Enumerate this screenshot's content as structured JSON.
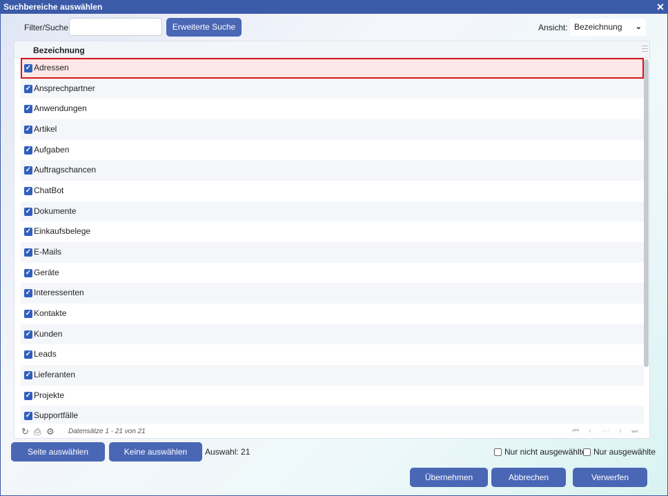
{
  "dialog": {
    "title": "Suchbereiche auswählen",
    "close_glyph": "✕"
  },
  "filter": {
    "label": "Filter/Suche:",
    "value": "",
    "placeholder": ""
  },
  "extended_search_label": "Erweiterte Suche",
  "view": {
    "label": "Ansicht:",
    "selected": "Bezeichnung"
  },
  "grid": {
    "column_header": "Bezeichnung",
    "rows": [
      {
        "label": "Adressen",
        "checked": true,
        "highlighted": true
      },
      {
        "label": "Ansprechpartner",
        "checked": true
      },
      {
        "label": "Anwendungen",
        "checked": true
      },
      {
        "label": "Artikel",
        "checked": true
      },
      {
        "label": "Aufgaben",
        "checked": true
      },
      {
        "label": "Auftragschancen",
        "checked": true
      },
      {
        "label": "ChatBot",
        "checked": true
      },
      {
        "label": "Dokumente",
        "checked": true
      },
      {
        "label": "Einkaufsbelege",
        "checked": true
      },
      {
        "label": "E-Mails",
        "checked": true
      },
      {
        "label": "Geräte",
        "checked": true
      },
      {
        "label": "Interessenten",
        "checked": true
      },
      {
        "label": "Kontakte",
        "checked": true
      },
      {
        "label": "Kunden",
        "checked": true
      },
      {
        "label": "Leads",
        "checked": true
      },
      {
        "label": "Lieferanten",
        "checked": true
      },
      {
        "label": "Projekte",
        "checked": true
      },
      {
        "label": "Supportfälle",
        "checked": true
      }
    ],
    "pager": {
      "info": "Datensätze 1 - 21 von 21",
      "icons": [
        "refresh-icon",
        "print-icon",
        "settings-icon"
      ],
      "nav_glyphs": {
        "first": "⏮",
        "prev": "‹",
        "ellipsis": "···",
        "next": "›",
        "last": "⏭"
      }
    }
  },
  "footer": {
    "select_page_label": "Seite auswählen",
    "select_none_label": "Keine auswählen",
    "selection_count": "Auswahl: 21",
    "only_unselected_label": "Nur nicht ausgewählte",
    "only_selected_label": "Nur ausgewählte",
    "apply_label": "Übernehmen",
    "cancel_label": "Abbrechen",
    "discard_label": "Verwerfen"
  },
  "colors": {
    "accent": "#4a67b5",
    "titlebar": "#3b5ba9",
    "checkbox": "#2f5fbd",
    "highlight_border": "#d6141c"
  }
}
